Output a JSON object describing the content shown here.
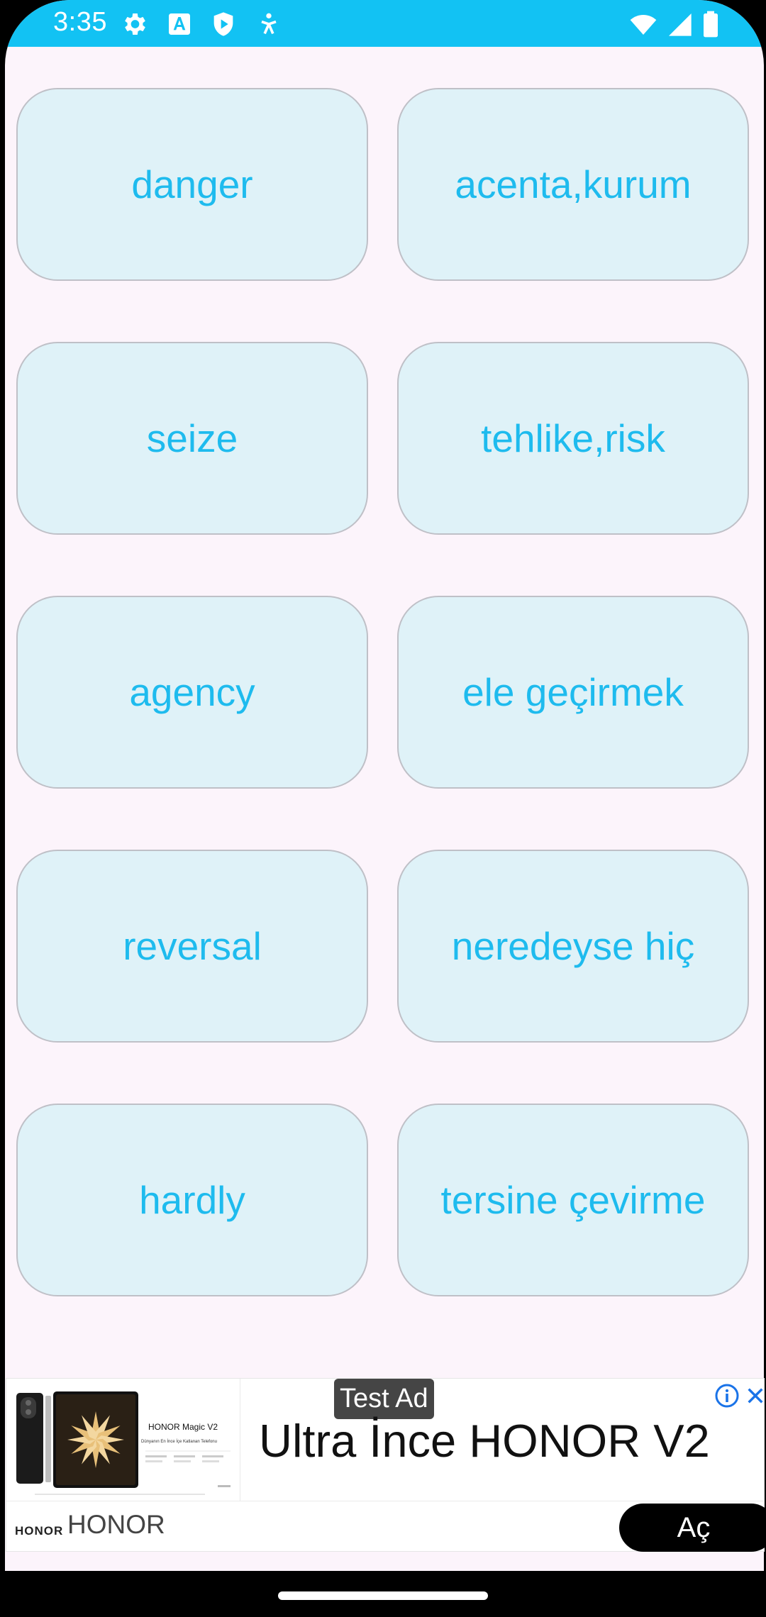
{
  "status_bar": {
    "time": "3:35",
    "color": "#12C2F3",
    "icons": [
      "gear-icon",
      "font-a-icon",
      "shield-play-icon",
      "accessibility-icon",
      "wifi-icon",
      "signal-icon",
      "battery-icon"
    ]
  },
  "cards": [
    {
      "label": "danger"
    },
    {
      "label": "acenta,kurum"
    },
    {
      "label": "seize"
    },
    {
      "label": "tehlike,risk"
    },
    {
      "label": "agency"
    },
    {
      "label": "ele geçirmek"
    },
    {
      "label": "reversal"
    },
    {
      "label": "neredeyse hiç"
    },
    {
      "label": "hardly"
    },
    {
      "label": "tersine çevirme"
    }
  ],
  "colors": {
    "background": "#FCF4FB",
    "card_fill": "#DFF2F8",
    "card_border": "#BFC0C7",
    "card_text": "#1EBBEE"
  },
  "ad": {
    "badge": "Test Ad",
    "headline": "Ultra İnce HONOR V2",
    "brand_logo": "HONOR",
    "brand_name": "HONOR",
    "cta_label": "Aç",
    "image_product_name": "HONOR Magic V2",
    "image_tagline": "Dünyanın En İnce İçe Katlanan Telefonu"
  }
}
